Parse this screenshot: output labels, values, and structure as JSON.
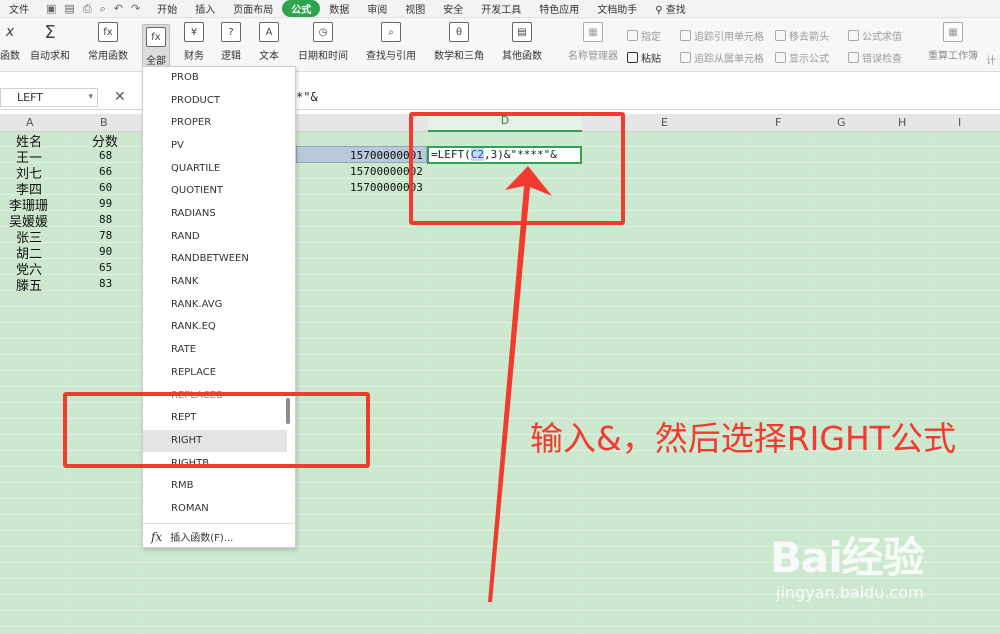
{
  "menubar": {
    "file": "文件",
    "tabs": [
      "开始",
      "插入",
      "页面布局",
      "公式",
      "数据",
      "审阅",
      "视图",
      "安全",
      "开发工具",
      "特色应用",
      "文档助手"
    ],
    "active_tab": "公式",
    "search": "查找"
  },
  "ribbon": {
    "buttons": [
      "函数",
      "自动求和",
      "常用函数",
      "全部",
      "财务",
      "逻辑",
      "文本",
      "日期和时间",
      "查找与引用",
      "数学和三角",
      "其他函数",
      "名称管理器"
    ],
    "small": [
      "指定",
      "粘贴",
      "追踪引用单元格",
      "追踪从属单元格",
      "移去箭头",
      "显示公式",
      "公式求值",
      "错误检查",
      "重算工作簿",
      "计"
    ]
  },
  "formula_bar": {
    "name_box": "LEFT",
    "content": "*\"&"
  },
  "columns": [
    "A",
    "B",
    "D",
    "E",
    "F",
    "G",
    "H",
    "I"
  ],
  "sheet": {
    "headers": [
      "姓名",
      "分数"
    ],
    "rows": [
      [
        "王一",
        "68"
      ],
      [
        "刘七",
        "66"
      ],
      [
        "李四",
        "60"
      ],
      [
        "李珊珊",
        "99"
      ],
      [
        "吴媛媛",
        "88"
      ],
      [
        "张三",
        "78"
      ],
      [
        "胡二",
        "90"
      ],
      [
        "党六",
        "65"
      ],
      [
        "滕五",
        "83"
      ]
    ],
    "phones": [
      "15700000001",
      "15700000002",
      "15700000003"
    ],
    "active_formula_pre": "=LEFT(",
    "active_formula_ref": "C2",
    "active_formula_post": ",3)&\"****\"&"
  },
  "function_list": {
    "items": [
      "PROB",
      "PRODUCT",
      "PROPER",
      "PV",
      "QUARTILE",
      "QUOTIENT",
      "RADIANS",
      "RAND",
      "RANDBETWEEN",
      "RANK",
      "RANK.AVG",
      "RANK.EQ",
      "RATE",
      "REPLACE",
      "REPLACEB",
      "REPT",
      "RIGHT",
      "RIGHTB",
      "RMB",
      "ROMAN"
    ],
    "highlighted": "RIGHT",
    "insert_label": "插入函数(F)..."
  },
  "annotation": {
    "text": "输入&，然后选择RIGHT公式",
    "color": "#f23a2e"
  },
  "watermark": {
    "brand": "Bai经验",
    "url": "jingyan.baidu.com"
  }
}
